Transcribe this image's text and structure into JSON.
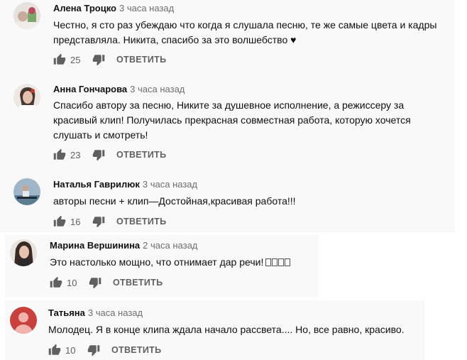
{
  "comments": [
    {
      "author": "Алена Троцко",
      "time": "3 часа назад",
      "text": "Честно, я сто раз убеждаю что когда я слушала песню, те же самые цвета и кадры представляла. Никита, спасибо за это волшебство ♥",
      "likes": "25",
      "reply_label": "ОТВЕТИТЬ"
    },
    {
      "author": "Анна Гончарова",
      "time": "3 часа назад",
      "text": "Спасибо автору за песню, Никите за душевное исполнение, а режиссеру за красивый клип! Получилась прекрасная совместная работа, которую хочется слушать и смотреть!",
      "likes": "23",
      "reply_label": "ОТВЕТИТЬ"
    },
    {
      "author": "Наталья Гаврилюк",
      "time": "3 часа назад",
      "text": "авторы песни + клип—Достойная,красивая работа!!!",
      "likes": "16",
      "reply_label": "ОТВЕТИТЬ"
    },
    {
      "author": "Марина Вершинина",
      "time": "2 часа назад",
      "text": "Это настолько мощно, что отнимает дар речи!",
      "likes": "10",
      "reply_label": "ОТВЕТИТЬ"
    },
    {
      "author": "Татьяна",
      "time": "3 часа назад",
      "text": "Молодец. Я в конце клипа ждала начало рассвета.... Но, все равно, красиво.",
      "likes": "10",
      "reply_label": "ОТВЕТИТЬ"
    }
  ],
  "colors": {
    "panel": "#f9f9f9",
    "meta": "#606060",
    "avatar_default": "#c9403a"
  },
  "icons": {
    "like": "thumbs-up-icon",
    "dislike": "thumbs-down-icon"
  }
}
